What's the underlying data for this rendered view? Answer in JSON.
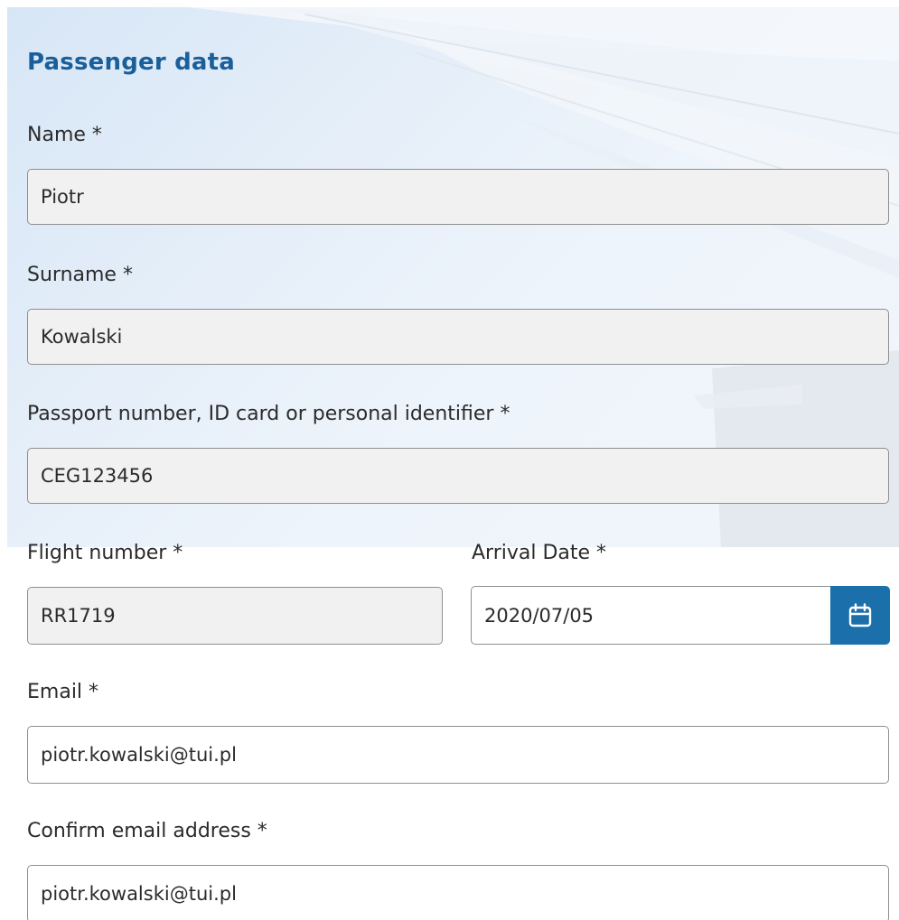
{
  "form": {
    "title": "Passenger data",
    "name": {
      "label": "Name *",
      "value": "Piotr"
    },
    "surname": {
      "label": "Surname *",
      "value": "Kowalski"
    },
    "passport": {
      "label": "Passport number, ID card or personal identifier *",
      "value": "CEG123456"
    },
    "flight_number": {
      "label": "Flight number *",
      "value": "RR1719"
    },
    "arrival_date": {
      "label": "Arrival Date *",
      "value": "2020/07/05",
      "icon": "calendar-icon"
    },
    "email": {
      "label": "Email *",
      "value": "piotr.kowalski@tui.pl"
    },
    "confirm_email": {
      "label": "Confirm email address *",
      "value": "piotr.kowalski@tui.pl"
    }
  },
  "colors": {
    "heading": "#1a5f9a",
    "accent_button": "#1b6fab",
    "readonly_bg": "#f1f1f1",
    "border": "#8f8f8f"
  }
}
